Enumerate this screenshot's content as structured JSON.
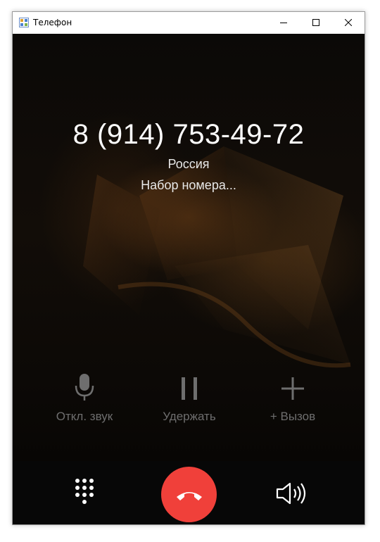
{
  "window": {
    "title": "Телефон"
  },
  "call": {
    "number": "8 (914) 753-49-72",
    "country": "Россия",
    "status": "Набор номера..."
  },
  "actions": {
    "mute_label": "Откл. звук",
    "hold_label": "Удержать",
    "add_label": "+ Вызов"
  },
  "icons": {
    "mute": "microphone-icon",
    "hold": "pause-icon",
    "add": "plus-icon",
    "keypad": "keypad-icon",
    "end_call": "phone-hangup-icon",
    "speaker": "speaker-icon"
  },
  "colors": {
    "end_call": "#f0403a",
    "disabled_text": "#6e6e6e",
    "primary_text": "#ffffff"
  }
}
